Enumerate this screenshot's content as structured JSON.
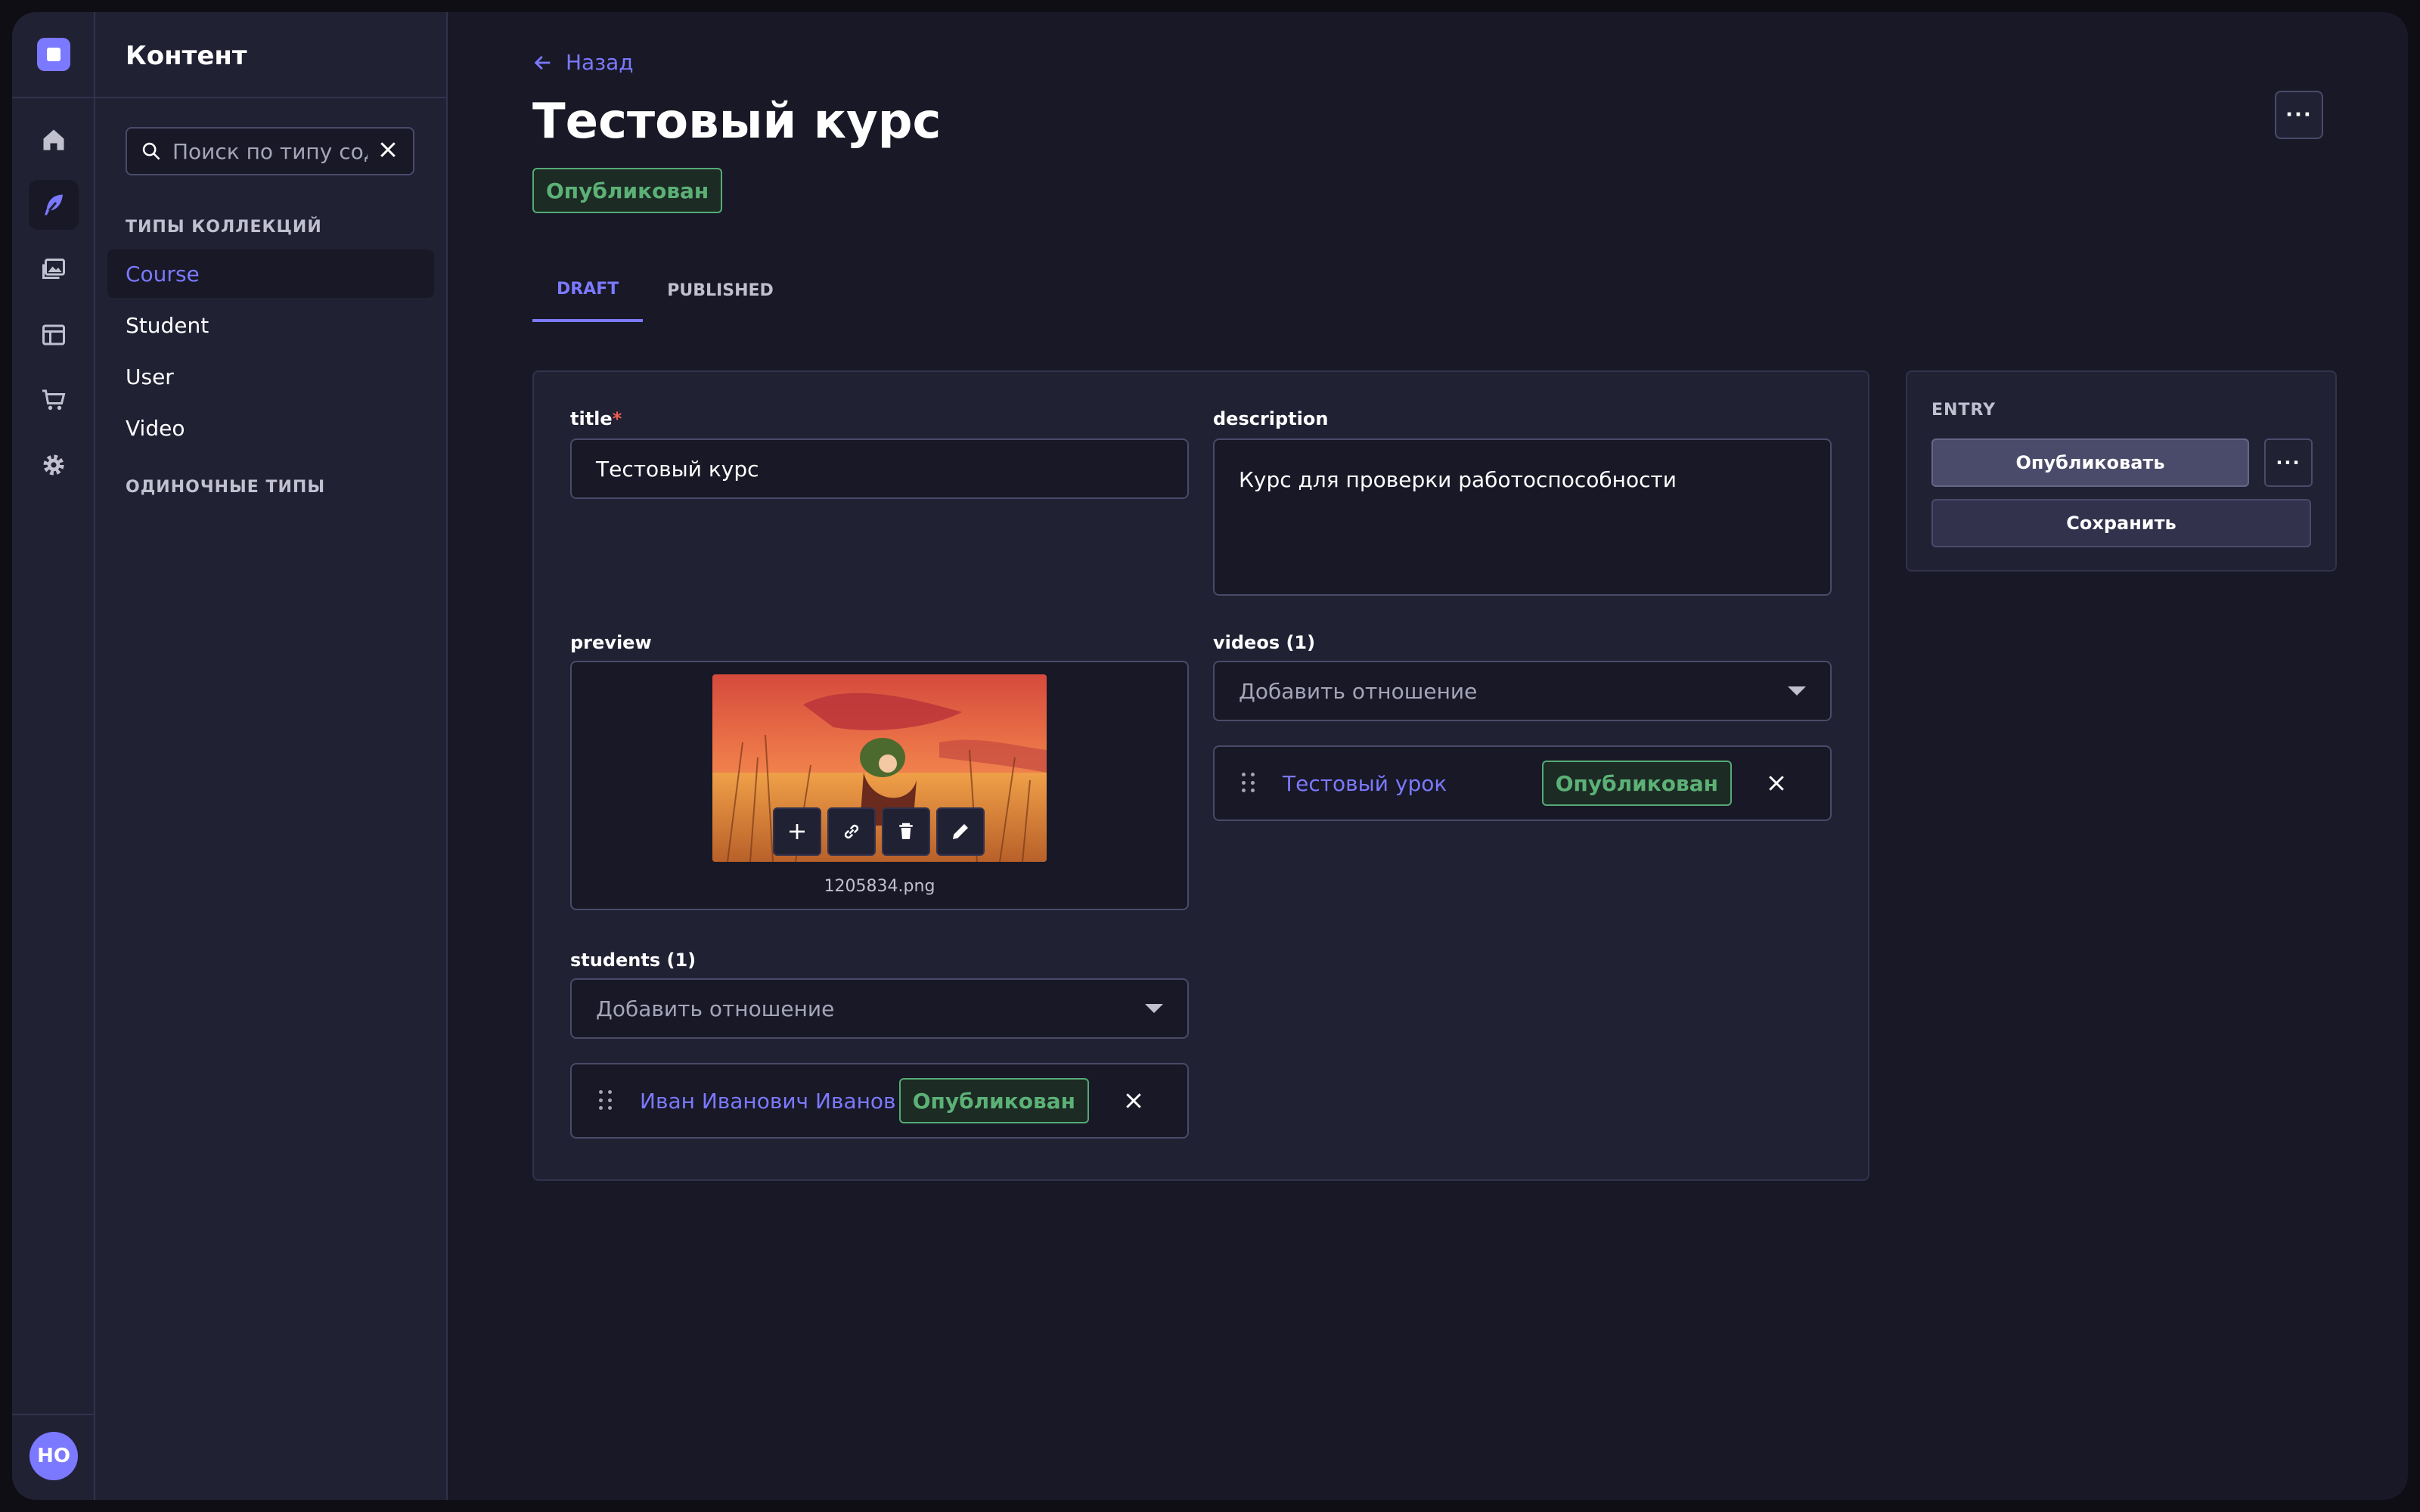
{
  "rail": {
    "icons": [
      "home-icon",
      "content-manager-icon",
      "media-library-icon",
      "content-type-builder-icon",
      "marketplace-icon",
      "settings-icon"
    ],
    "avatar_initials": "НО"
  },
  "subnav": {
    "title": "Контент",
    "search_placeholder": "Поиск по типу содержимого",
    "collection_types_label": "ТИПЫ КОЛЛЕКЦИЙ",
    "collection_types": [
      "Course",
      "Student",
      "User",
      "Video"
    ],
    "active_item": "Course",
    "single_types_label": "ОДИНОЧНЫЕ ТИПЫ"
  },
  "header": {
    "back_label": "Назад",
    "title": "Тестовый курс",
    "status": "Опубликован",
    "more_label": "···"
  },
  "tabs": [
    {
      "label": "DRAFT",
      "active": true
    },
    {
      "label": "PUBLISHED",
      "active": false
    }
  ],
  "form": {
    "title": {
      "label": "title",
      "required_mark": "*",
      "value": "Тестовый курс"
    },
    "description": {
      "label": "description",
      "value": "Курс для проверки работоспособности"
    },
    "preview": {
      "label": "preview",
      "filename": "1205834.png"
    },
    "videos": {
      "label": "videos (1)",
      "placeholder": "Добавить отношение",
      "items": [
        {
          "title": "Тестовый урок",
          "status": "Опубликован"
        }
      ]
    },
    "students": {
      "label": "students (1)",
      "placeholder": "Добавить отношение",
      "items": [
        {
          "title": "Иван Иванович Иванов",
          "status": "Опубликован"
        }
      ]
    }
  },
  "entry_panel": {
    "title": "ENTRY",
    "publish_label": "Опубликовать",
    "more_label": "···",
    "save_label": "Сохранить"
  },
  "colors": {
    "accent": "#7b79ff",
    "success": "#5cb176",
    "background": "#181826",
    "surface": "#212134"
  }
}
